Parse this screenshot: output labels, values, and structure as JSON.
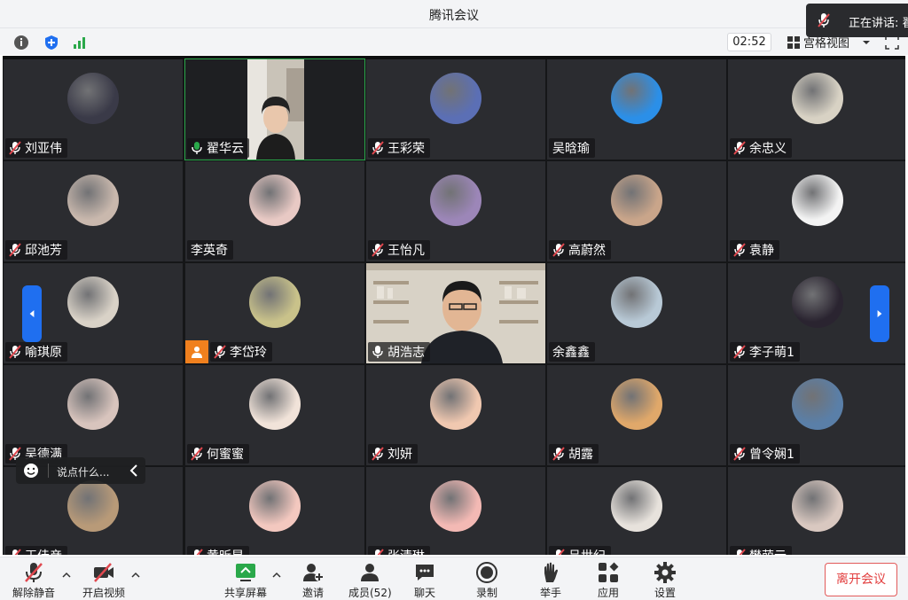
{
  "window": {
    "title": "腾讯会议"
  },
  "speaking": {
    "label": "正在讲话: 翟"
  },
  "toolbar": {
    "timer": "02:52",
    "view_label": "宫格视图"
  },
  "participants": [
    {
      "name": "刘亚伟",
      "mic": "muted",
      "avatar_color": "#3a3a48"
    },
    {
      "name": "翟华云",
      "mic": "on",
      "video": true
    },
    {
      "name": "王彩荣",
      "mic": "muted",
      "avatar_color": "#5b6fb5"
    },
    {
      "name": "吴晗瑜",
      "mic": "none",
      "avatar_color": "#2b8fe8"
    },
    {
      "name": "余忠义",
      "mic": "muted",
      "avatar_color": "#d8d2c4"
    },
    {
      "name": "邱池芳",
      "mic": "muted",
      "avatar_color": "#c9b8ad"
    },
    {
      "name": "李英奇",
      "mic": "none",
      "avatar_color": "#e8c9c4"
    },
    {
      "name": "王怡凡",
      "mic": "muted",
      "avatar_color": "#9c86b8"
    },
    {
      "name": "高蔚然",
      "mic": "muted",
      "avatar_color": "#c9a58a"
    },
    {
      "name": "袁静",
      "mic": "muted",
      "avatar_color": "#f3f3f3"
    },
    {
      "name": "喻琪原",
      "mic": "muted",
      "avatar_color": "#d9d2c7"
    },
    {
      "name": "李岱玲",
      "mic": "muted",
      "avatar_color": "#c9c28a",
      "host_icon": true
    },
    {
      "name": "胡浩志",
      "mic": "mic",
      "video": true
    },
    {
      "name": "余鑫鑫",
      "mic": "none",
      "avatar_color": "#b8c9d6"
    },
    {
      "name": "李子萌1",
      "mic": "muted",
      "avatar_color": "#2a2430"
    },
    {
      "name": "吴德满",
      "mic": "muted",
      "avatar_color": "#d8c4bd"
    },
    {
      "name": "何蜜蜜",
      "mic": "muted",
      "avatar_color": "#f1e3d9"
    },
    {
      "name": "刘妍",
      "mic": "muted",
      "avatar_color": "#f0c8b0"
    },
    {
      "name": "胡露",
      "mic": "muted",
      "avatar_color": "#e0a86a"
    },
    {
      "name": "曾令娴1",
      "mic": "muted",
      "avatar_color": "#5a7fa8"
    },
    {
      "name": "王佳彦",
      "mic": "muted",
      "avatar_color": "#b89a78"
    },
    {
      "name": "黄昕昱",
      "mic": "muted",
      "avatar_color": "#f3c8bf"
    },
    {
      "name": "张清琳",
      "mic": "muted",
      "avatar_color": "#f3b9b4"
    },
    {
      "name": "吕世纪",
      "mic": "muted",
      "avatar_color": "#e7e2dc"
    },
    {
      "name": "樊萌云",
      "mic": "muted",
      "avatar_color": "#d9c8c0"
    }
  ],
  "chat": {
    "placeholder": "说点什么..."
  },
  "bottom": {
    "unmute": "解除静音",
    "start_video": "开启视频",
    "share": "共享屏幕",
    "invite": "邀请",
    "members": "成员(52)",
    "chat": "聊天",
    "record": "录制",
    "raise_hand": "举手",
    "apps": "应用",
    "settings": "设置",
    "leave": "离开会议"
  },
  "colors": {
    "accent": "#1f6ff0",
    "leave": "#e23d3d",
    "share": "#2aa84a",
    "muted": "#e0484f"
  }
}
